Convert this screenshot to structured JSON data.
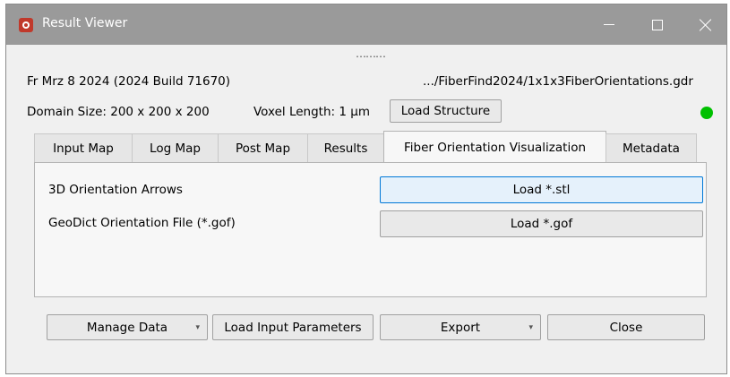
{
  "window": {
    "title": "Result Viewer",
    "app_icon": "app-logo-icon",
    "controls": [
      "minimize-icon",
      "maximize-icon",
      "close-icon"
    ]
  },
  "header": {
    "grip": "………",
    "version": "Fr Mrz 8 2024 (2024 Build 71670)",
    "file_path": ".../FiberFind2024/1x1x3FiberOrientations.gdr",
    "domain_size": "Domain Size: 200 x 200 x 200",
    "voxel_length": "Voxel Length: 1 µm",
    "load_structure_label": "Load Structure",
    "status_color": "#00c000"
  },
  "tabs": [
    {
      "label": "Input Map"
    },
    {
      "label": "Log Map"
    },
    {
      "label": "Post Map"
    },
    {
      "label": "Results"
    },
    {
      "label": "Fiber Orientation Visualization",
      "active": true
    },
    {
      "label": "Metadata"
    }
  ],
  "panel": {
    "rows": [
      {
        "label": "3D Orientation Arrows",
        "button": "Load *.stl"
      },
      {
        "label": "GeoDict Orientation File (*.gof)",
        "button": "Load *.gof"
      }
    ]
  },
  "footer": {
    "manage_data": "Manage Data",
    "load_input_parameters": "Load Input Parameters",
    "export": "Export",
    "close": "Close"
  },
  "colors": {
    "titlebar": "#9a9a9a",
    "accent": "#0078d7"
  }
}
